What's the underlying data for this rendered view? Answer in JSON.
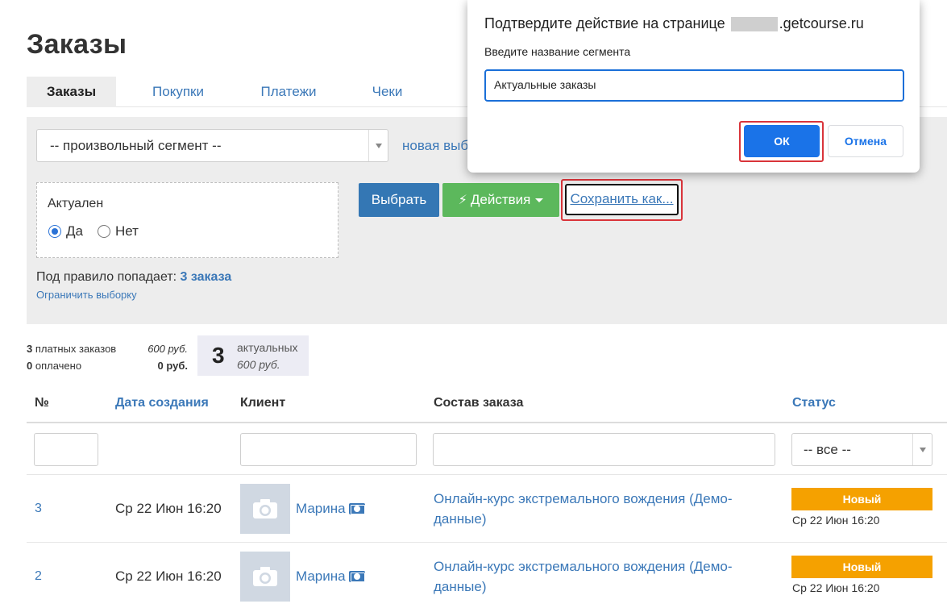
{
  "page": {
    "title": "Заказы"
  },
  "tabs": [
    "Заказы",
    "Покупки",
    "Платежи",
    "Чеки"
  ],
  "filter": {
    "segment_select": "-- произвольный сегмент --",
    "new_selection_link": "новая выб",
    "rule_label": "Актуален",
    "radio_yes": "Да",
    "radio_no": "Нет",
    "select_button": "Выбрать",
    "actions_button": "Действия",
    "save_as_button": "Сохранить как...",
    "rule_count_prefix": "Под правило попадает:",
    "rule_count_value": "3 заказа",
    "limit_link": "Ограничить выборку"
  },
  "stats": {
    "paid_count": "3",
    "paid_label": "платных заказов",
    "paid_sum": "600 руб.",
    "settled_count": "0",
    "settled_label": "оплачено",
    "settled_sum": "0 руб.",
    "actual_count": "3",
    "actual_label": "актуальных",
    "actual_sum": "600 руб."
  },
  "table": {
    "headers": {
      "num": "№",
      "date": "Дата создания",
      "client": "Клиент",
      "order": "Состав заказа",
      "status": "Статус"
    },
    "status_filter": "-- все --",
    "rows": [
      {
        "num": "3",
        "date": "Ср 22 Июн 16:20",
        "client": "Марина",
        "product": "Онлайн-курс экстремального вождения (Демо-данные)",
        "status": "Новый",
        "status_date": "Ср 22 Июн 16:20"
      },
      {
        "num": "2",
        "date": "Ср 22 Июн 16:20",
        "client": "Марина",
        "product": "Онлайн-курс экстремального вождения (Демо-данные)",
        "status": "Новый",
        "status_date": "Ср 22 Июн 16:20"
      }
    ]
  },
  "dialog": {
    "title_prefix": "Подтвердите действие на странице",
    "title_suffix": ".getcourse.ru",
    "prompt": "Введите название сегмента",
    "input_value": "Актуальные заказы",
    "ok_button": "ОК",
    "cancel_button": "Отмена"
  },
  "colors": {
    "link": "#3b78b8",
    "primary": "#3477b4",
    "success": "#5cb85c",
    "status_new": "#f5a100",
    "dialog_primary": "#1a73e8",
    "highlight": "#d9343a"
  }
}
